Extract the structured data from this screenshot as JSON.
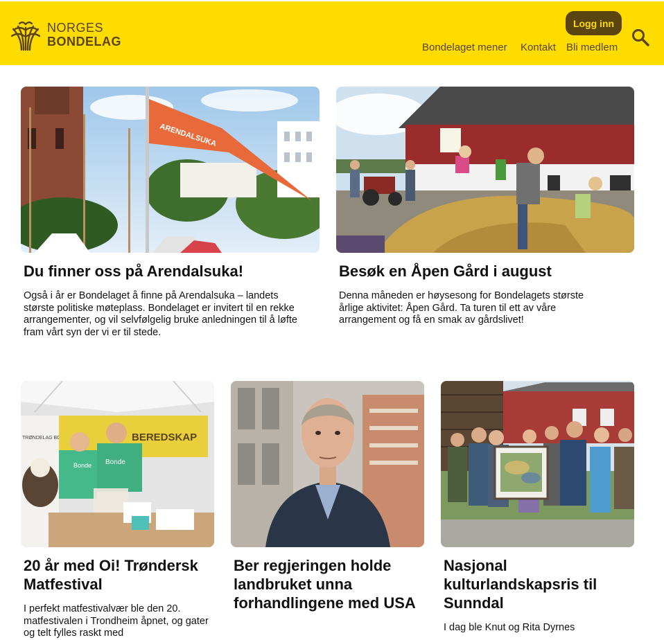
{
  "header": {
    "logo_line1": "NORGES",
    "logo_line2": "BONDELAG",
    "login_label": "Logg inn",
    "nav": [
      "Bondelaget mener",
      "Kontakt",
      "Bli medlem"
    ],
    "search_icon": "search-icon",
    "colors": {
      "bar": "#ffdc00",
      "brand_brown": "#5a4410"
    }
  },
  "cards": [
    {
      "title": "Du finner oss på Arendalsuka!",
      "description": "Også i år er Bondelaget å finne på Arendalsuka – landets største politiske møteplass. Bondelaget er invitert til en rekke arrangementer, og vil selvfølgelig bruke anledningen til å løfte fram vårt syn der vi er til stede.",
      "flag_text": "ARENDALSUKA"
    },
    {
      "title": "Besøk en Åpen Gård i august",
      "description": "Denna måneden er høysesong for Bondelagets største årlige aktivitet: Åpen Gård. Ta turen til ett av våre arrangement og få en smak av gårdslivet!"
    },
    {
      "title": "20 år med Oi! Trøndersk Matfestival",
      "description": "I perfekt matfestivalvær ble den 20. matfestivalen i Trondheim åpnet, og gater og telt fylles raskt med",
      "banner_text": "BEREDSKAP",
      "shirt_text": "Bonde",
      "sign_text": "TRØNDELAG BONDELAG"
    },
    {
      "title": "Ber regjeringen holde landbruket unna forhandlingene med USA",
      "description": ""
    },
    {
      "title": "Nasjonal kulturlandskapsris til Sunndal",
      "description": "I dag ble Knut og Rita Dyrnes"
    }
  ]
}
